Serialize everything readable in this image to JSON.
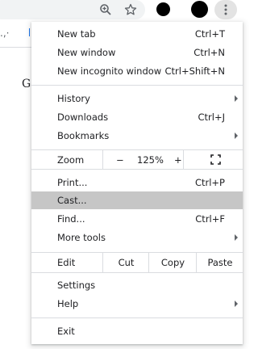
{
  "toolbar": {
    "icons": [
      "zoom-icon",
      "star-icon",
      "extension-icon",
      "profile-avatar",
      "more-vert-icon"
    ]
  },
  "page": {
    "frag1": ".,·",
    "g_letter": "G"
  },
  "menu": {
    "items": {
      "new_tab": {
        "label": "New tab",
        "shortcut": "Ctrl+T"
      },
      "new_window": {
        "label": "New window",
        "shortcut": "Ctrl+N"
      },
      "incognito": {
        "label": "New incognito window",
        "shortcut": "Ctrl+Shift+N"
      },
      "history": {
        "label": "History"
      },
      "downloads": {
        "label": "Downloads",
        "shortcut": "Ctrl+J"
      },
      "bookmarks": {
        "label": "Bookmarks"
      },
      "print": {
        "label": "Print...",
        "shortcut": "Ctrl+P"
      },
      "cast": {
        "label": "Cast..."
      },
      "find": {
        "label": "Find...",
        "shortcut": "Ctrl+F"
      },
      "more_tools": {
        "label": "More tools"
      },
      "settings": {
        "label": "Settings"
      },
      "help": {
        "label": "Help"
      },
      "exit": {
        "label": "Exit"
      }
    },
    "zoom": {
      "label": "Zoom",
      "minus": "−",
      "value": "125%",
      "plus": "+"
    },
    "edit": {
      "label": "Edit",
      "cut": "Cut",
      "copy": "Copy",
      "paste": "Paste"
    },
    "highlight_color": "#c6c6c6"
  }
}
